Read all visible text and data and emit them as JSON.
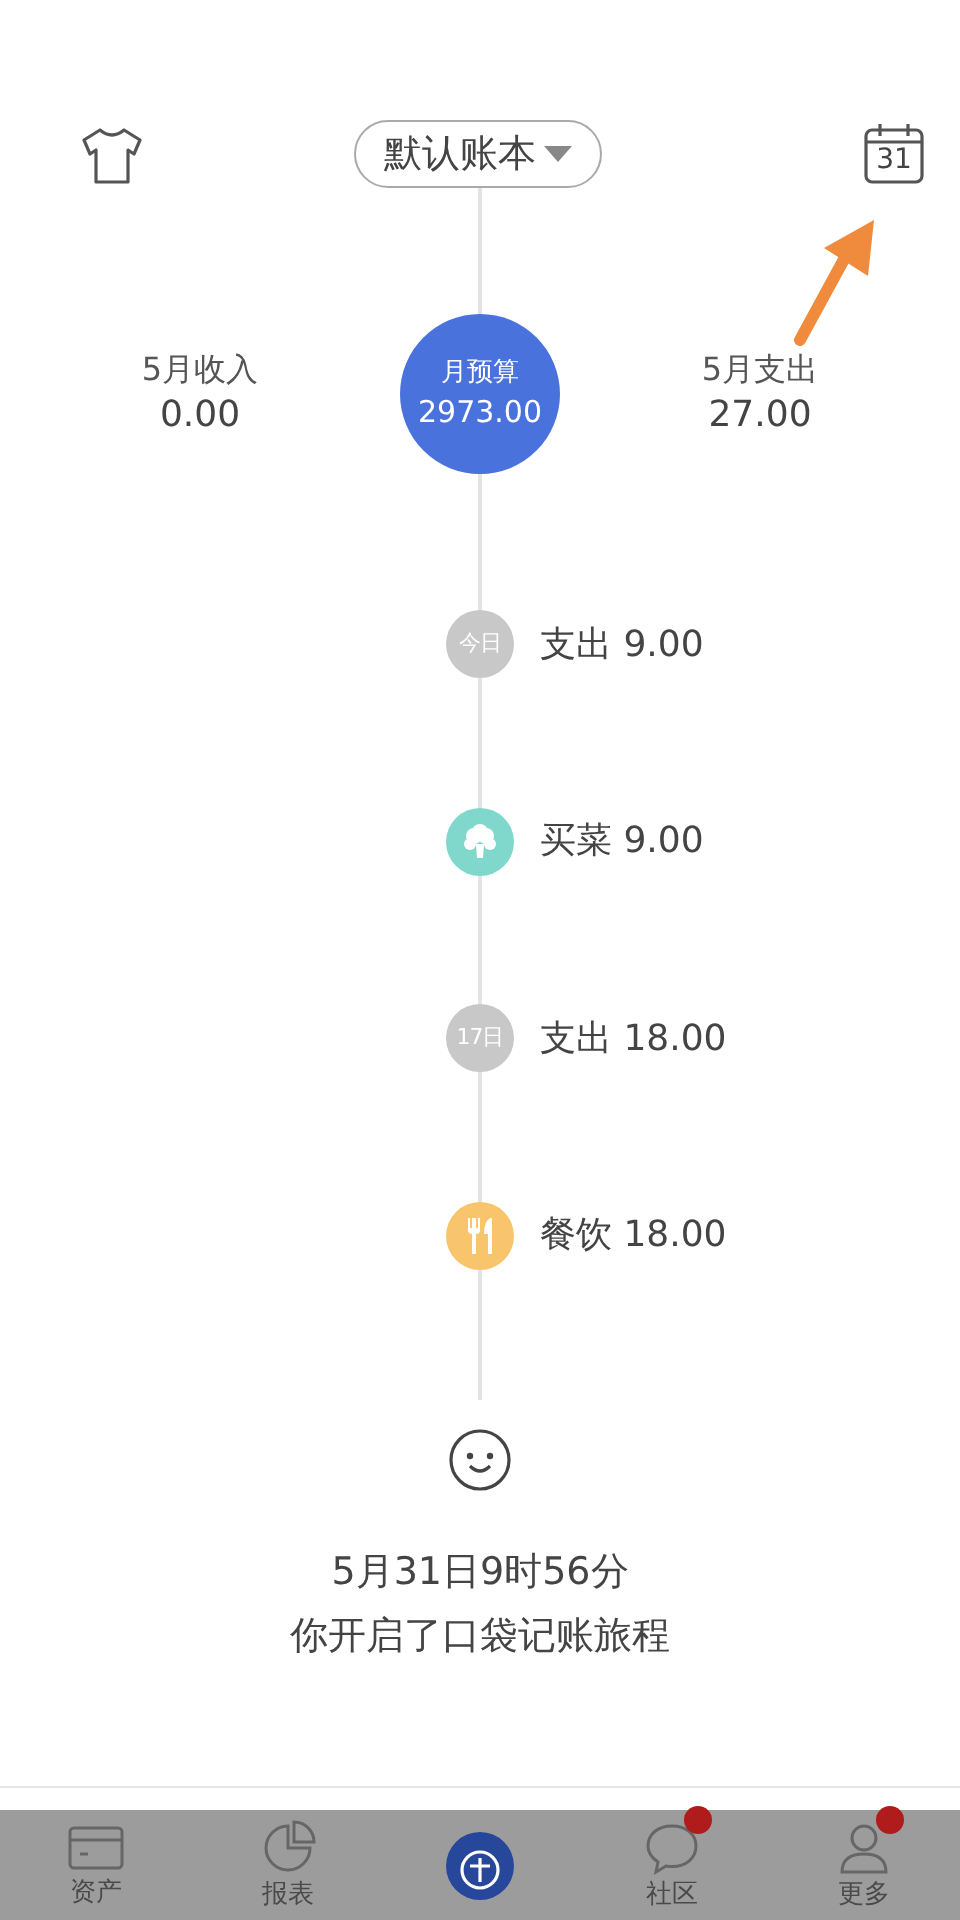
{
  "header": {
    "book": "默认账本"
  },
  "calendar": {
    "day": "31"
  },
  "summary": {
    "income_label": "5月收入",
    "income": "0.00",
    "budget_label": "月预算",
    "budget": "2973.00",
    "expense_label": "5月支出",
    "expense": "27.00"
  },
  "entries": [
    {
      "kind": "date",
      "date": "今日",
      "text": "支出 9.00"
    },
    {
      "kind": "vegetable",
      "color": "#7fd8cb",
      "text": "买菜 9.00"
    },
    {
      "kind": "date",
      "date": "17日",
      "text": "支出 18.00"
    },
    {
      "kind": "dining",
      "color": "#f8c46c",
      "text": "餐饮 18.00"
    }
  ],
  "start": {
    "line1": "5月31日9时56分",
    "line2": "你开启了口袋记账旅程"
  },
  "tabs": [
    {
      "kind": "wallet",
      "label": "资产",
      "badge": false
    },
    {
      "kind": "chart",
      "label": "报表",
      "badge": false
    },
    {
      "kind": "add",
      "badge": false
    },
    {
      "kind": "chat",
      "label": "社区",
      "badge": true
    },
    {
      "kind": "profile",
      "label": "更多",
      "badge": true
    }
  ]
}
